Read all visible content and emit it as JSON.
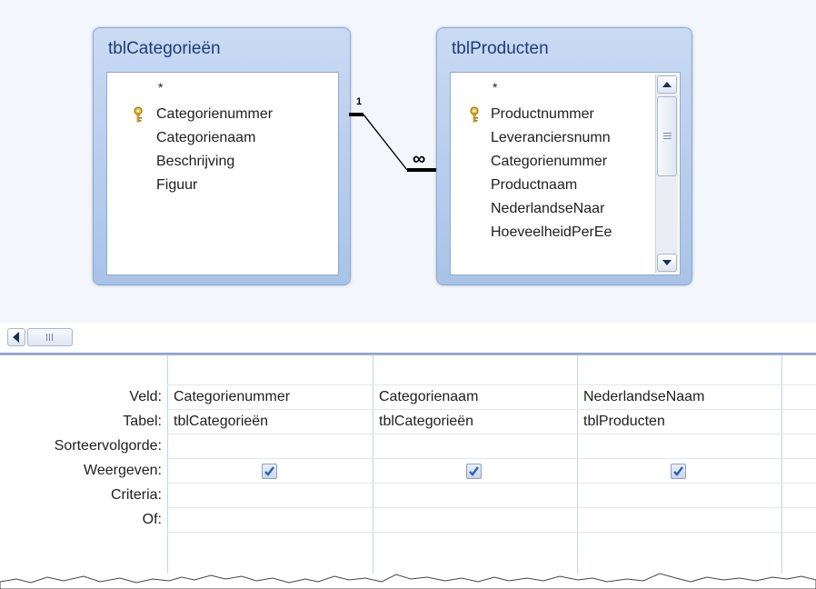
{
  "tables": [
    {
      "title": "tblCategorieën",
      "fields": [
        "*",
        "Categorienummer",
        "Categorienaam",
        "Beschrijving",
        "Figuur"
      ],
      "key_field": "Categorienummer"
    },
    {
      "title": "tblProducten",
      "fields": [
        "*",
        "Productnummer",
        "Leveranciersnumn",
        "Categorienummer",
        "Productnaam",
        "NederlandseNaar",
        "HoeveelheidPerEe"
      ],
      "key_field": "Productnummer"
    }
  ],
  "relationship": {
    "one_symbol": "1",
    "many_symbol": "∞"
  },
  "grid": {
    "row_labels": [
      "Veld:",
      "Tabel:",
      "Sorteervolgorde:",
      "Weergeven:",
      "Criteria:",
      "Of:"
    ],
    "columns": [
      {
        "veld": "Categorienummer",
        "tabel": "tblCategorieën",
        "weergeven": true
      },
      {
        "veld": "Categorienaam",
        "tabel": "tblCategorieën",
        "weergeven": true
      },
      {
        "veld": "NederlandseNaam",
        "tabel": "tblProducten",
        "weergeven": true
      }
    ]
  },
  "icons": {
    "key": "key-icon",
    "scroll_up": "arrow-up-icon",
    "scroll_down": "arrow-down-icon",
    "scroll_left": "arrow-left-icon",
    "check": "checkmark-icon"
  },
  "colors": {
    "table_header": "#b6cdef",
    "table_title": "#1f3d73",
    "pane_background": "#f3f6fa",
    "checkmark": "#2e5fb0"
  }
}
